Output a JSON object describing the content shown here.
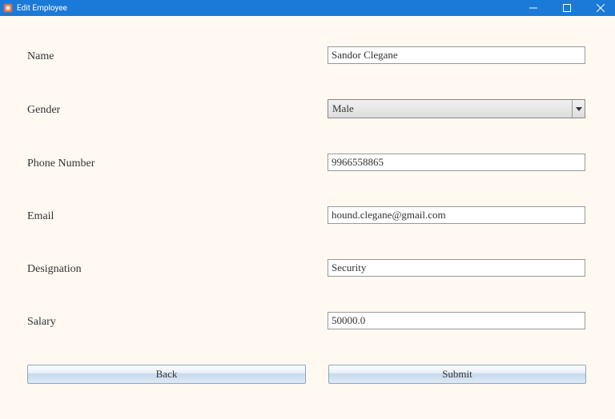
{
  "window": {
    "title": "Edit Employee"
  },
  "form": {
    "name_label": "Name",
    "name_value": "Sandor Clegane",
    "gender_label": "Gender",
    "gender_value": "Male",
    "phone_label": "Phone Number",
    "phone_value": "9966558865",
    "email_label": "Email",
    "email_value": "hound.clegane@gmail.com",
    "designation_label": "Designation",
    "designation_value": "Security",
    "salary_label": "Salary",
    "salary_value": "50000.0"
  },
  "buttons": {
    "back": "Back",
    "submit": "Submit"
  }
}
